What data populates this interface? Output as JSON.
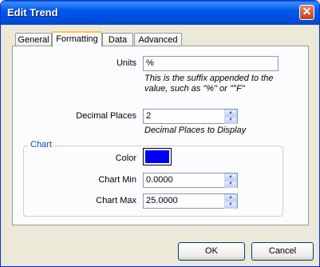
{
  "window": {
    "title": "Edit Trend"
  },
  "tabs": [
    {
      "label": "General"
    },
    {
      "label": "Formatting"
    },
    {
      "label": "Data"
    },
    {
      "label": "Advanced"
    }
  ],
  "units": {
    "label": "Units",
    "value": "%",
    "hint_line1": "This is the suffix appended to the",
    "hint_line2": "value, such as \"%\" or \"°F\""
  },
  "decimal_places": {
    "label": "Decimal Places",
    "value": "2",
    "hint": "Decimal Places to Display"
  },
  "chart_group": {
    "title": "Chart",
    "color_label": "Color",
    "color_value": "#0000ff",
    "min_label": "Chart Min",
    "min_value": "0.0000",
    "max_label": "Chart Max",
    "max_value": "25.0000"
  },
  "buttons": {
    "ok": "OK",
    "cancel": "Cancel"
  }
}
